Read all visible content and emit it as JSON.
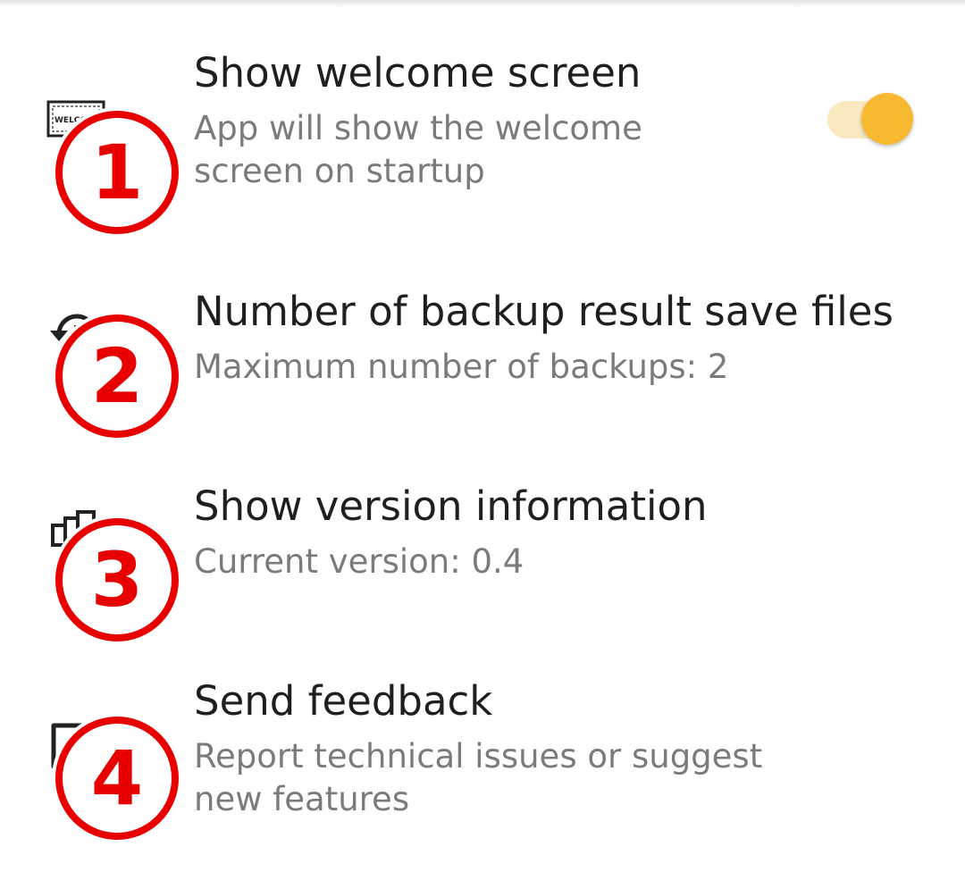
{
  "settings": [
    {
      "title": "Show welcome screen",
      "subtitle": "App will show the welcome screen on startup",
      "icon": "welcome-screen-icon",
      "icon_text": "WELCOME",
      "badge": "1",
      "toggle_on": true
    },
    {
      "title": "Number of backup result save files",
      "subtitle": "Maximum number of backups: 2",
      "icon": "backup-history-icon",
      "badge": "2"
    },
    {
      "title": "Show version information",
      "subtitle": "Current version: 0.4",
      "icon": "version-info-icon",
      "badge": "3"
    },
    {
      "title": "Send feedback",
      "subtitle": "Report technical issues or suggest new features",
      "icon": "feedback-icon",
      "badge": "4"
    }
  ],
  "colors": {
    "accent": "#f6b92f",
    "toggle_track": "#fae9bf",
    "annotation": "#e80000",
    "title_text": "#1f1f1f",
    "subtitle_text": "#7b7b7b"
  }
}
